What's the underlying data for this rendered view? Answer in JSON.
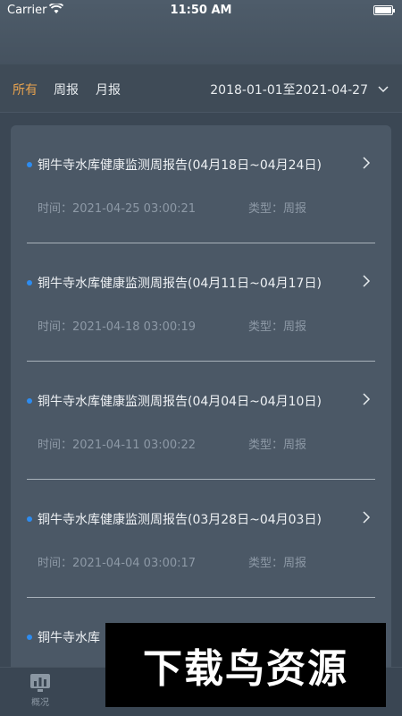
{
  "status_bar": {
    "carrier": "Carrier",
    "time": "11:50 AM"
  },
  "filters": {
    "tabs": [
      {
        "label": "所有",
        "active": true
      },
      {
        "label": "周报",
        "active": false
      },
      {
        "label": "月报",
        "active": false
      }
    ],
    "date_range": "2018-01-01至2021-04-27"
  },
  "reports": [
    {
      "title": "铜牛寺水库健康监测周报告(04月18日~04月24日)",
      "time": "时间：2021-04-25 03:00:21",
      "type": "类型：周报"
    },
    {
      "title": "铜牛寺水库健康监测周报告(04月11日~04月17日)",
      "time": "时间：2021-04-18 03:00:19",
      "type": "类型：周报"
    },
    {
      "title": "铜牛寺水库健康监测周报告(04月04日~04月10日)",
      "time": "时间：2021-04-11 03:00:22",
      "type": "类型：周报"
    },
    {
      "title": "铜牛寺水库健康监测周报告(03月28日~04月03日)",
      "time": "时间：2021-04-04 03:00:17",
      "type": "类型：周报"
    },
    {
      "title": "铜牛寺水库",
      "time": "",
      "type": ""
    }
  ],
  "tab_bar": {
    "overview_label": "概况"
  },
  "watermark": "下载鸟资源",
  "colors": {
    "accent": "#e8a34f",
    "bullet": "#2d8cf0",
    "card": "#4b5866",
    "background": "#3b4754"
  }
}
